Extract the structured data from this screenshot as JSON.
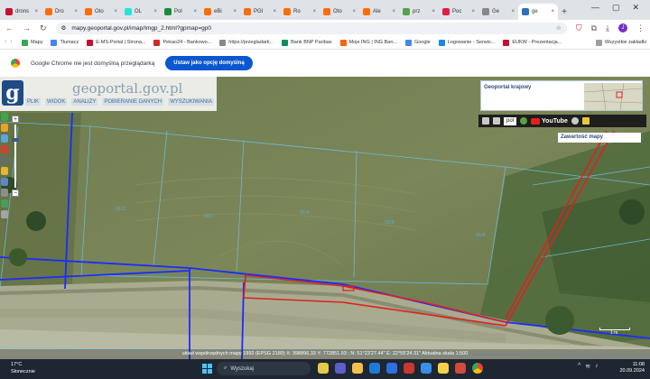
{
  "browser": {
    "tabs": [
      {
        "label": "drons",
        "color": "#c8102e"
      },
      {
        "label": "Dro",
        "color": "#ff6d00"
      },
      {
        "label": "Oto",
        "color": "#ff6d00"
      },
      {
        "label": "OL",
        "color": "#23e5db"
      },
      {
        "label": "Pol",
        "color": "#1b8a3a"
      },
      {
        "label": "eBi",
        "color": "#ff6d00"
      },
      {
        "label": "PGI",
        "color": "#ff6d00"
      },
      {
        "label": "Ro",
        "color": "#ff6d00"
      },
      {
        "label": "Oto",
        "color": "#ff6d00"
      },
      {
        "label": "Ale",
        "color": "#ff6d00"
      },
      {
        "label": "prz",
        "color": "#53a245"
      },
      {
        "label": "Poc",
        "color": "#e11d48"
      },
      {
        "label": "Ge",
        "color": "#888888"
      },
      {
        "label": "ge",
        "color": "#2e6fbd",
        "active": true
      }
    ],
    "url": "mapy.geoportal.gov.pl/imap/Imgp_2.html?gpmap=gp0",
    "profile_initial": "J",
    "bookmarks": [
      {
        "label": "Mapy",
        "color": "#34a853"
      },
      {
        "label": "Tłumacz",
        "color": "#4285f4"
      },
      {
        "label": "E-MS-Portal | Strona...",
        "color": "#c8102e"
      },
      {
        "label": "Pekao24 - Bankowo...",
        "color": "#d62828"
      },
      {
        "label": "https://przegladark...",
        "color": "#888888"
      },
      {
        "label": "Bank BNP Paribas",
        "color": "#00915a"
      },
      {
        "label": "Moje ING | ING Ban...",
        "color": "#ff6200"
      },
      {
        "label": "Google",
        "color": "#4285f4"
      },
      {
        "label": "Logowanie - Serwis...",
        "color": "#1e88e5"
      },
      {
        "label": "EUKW - Prezentacja...",
        "color": "#c8102e"
      }
    ],
    "all_bookmarks_label": "Wszystkie zakładki",
    "infobar_text": "Google Chrome nie jest domyślną przeglądarką",
    "infobar_button": "Ustaw jako opcję domyślną"
  },
  "geoportal": {
    "site_name": "geoportal.gov.pl",
    "menu": [
      "PLIK",
      "WIDOK",
      "ANALIZY",
      "POBIERANIE DANYCH",
      "WYSZUKIWANIA"
    ],
    "overview_title": "Geoportal krajowy",
    "language": "pol",
    "youtube_label": "YouTube",
    "layers_title": "Zawartość mapy",
    "parcels": [
      "91/1",
      "90/1",
      "91/4",
      "91/5",
      "91/6"
    ],
    "status_line": "układ współrzędnych mapy 1992 (EPSG 2180) X: 398896.33 Y: 772851.93 ; N: 51°23'27.44\" E: 22°55'24.31\" Aktualna skala 1:500",
    "scale_label": "1 m"
  },
  "taskbar": {
    "temperature": "17°C",
    "weather": "Słonecznie",
    "search_placeholder": "Wyszukaj",
    "time": "11:08",
    "date": "20.09.2024"
  }
}
